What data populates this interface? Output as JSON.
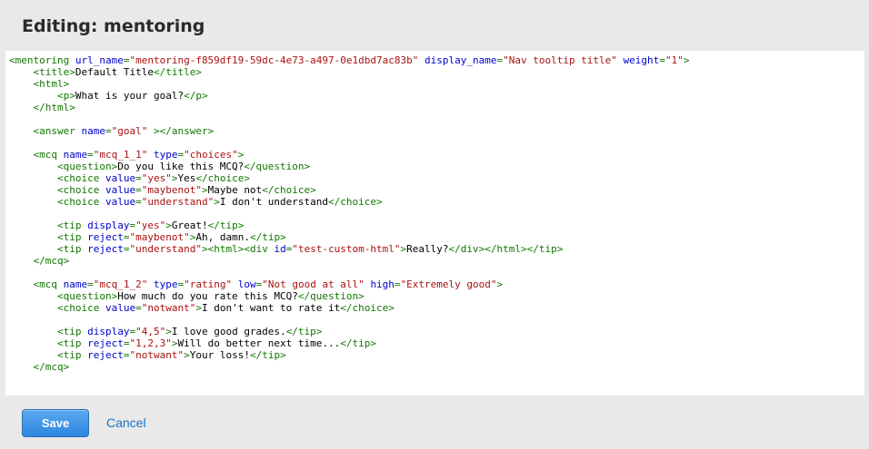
{
  "header": {
    "title": "Editing: mentoring"
  },
  "editor": {
    "lines": [
      [
        [
          "tag",
          "<mentoring "
        ],
        [
          "attr",
          "url_name"
        ],
        [
          "tag",
          "="
        ],
        [
          "val",
          "\"mentoring-f859df19-59dc-4e73-a497-0e1dbd7ac83b\""
        ],
        [
          "txt",
          " "
        ],
        [
          "attr",
          "display_name"
        ],
        [
          "tag",
          "="
        ],
        [
          "val",
          "\"Nav tooltip title\""
        ],
        [
          "txt",
          " "
        ],
        [
          "attr",
          "weight"
        ],
        [
          "tag",
          "="
        ],
        [
          "val",
          "\"1\""
        ],
        [
          "tag",
          ">"
        ]
      ],
      [
        [
          "txt",
          "    "
        ],
        [
          "tag",
          "<title>"
        ],
        [
          "txt",
          "Default Title"
        ],
        [
          "tag",
          "</title>"
        ]
      ],
      [
        [
          "txt",
          "    "
        ],
        [
          "tag",
          "<html>"
        ]
      ],
      [
        [
          "txt",
          "        "
        ],
        [
          "tag",
          "<p>"
        ],
        [
          "txt",
          "What is your goal?"
        ],
        [
          "tag",
          "</p>"
        ]
      ],
      [
        [
          "txt",
          "    "
        ],
        [
          "tag",
          "</html>"
        ]
      ],
      [
        [
          "txt",
          ""
        ]
      ],
      [
        [
          "txt",
          "    "
        ],
        [
          "tag",
          "<answer "
        ],
        [
          "attr",
          "name"
        ],
        [
          "tag",
          "="
        ],
        [
          "val",
          "\"goal\""
        ],
        [
          "tag",
          " ></answer>"
        ]
      ],
      [
        [
          "txt",
          ""
        ]
      ],
      [
        [
          "txt",
          "    "
        ],
        [
          "tag",
          "<mcq "
        ],
        [
          "attr",
          "name"
        ],
        [
          "tag",
          "="
        ],
        [
          "val",
          "\"mcq_1_1\""
        ],
        [
          "txt",
          " "
        ],
        [
          "attr",
          "type"
        ],
        [
          "tag",
          "="
        ],
        [
          "val",
          "\"choices\""
        ],
        [
          "tag",
          ">"
        ]
      ],
      [
        [
          "txt",
          "        "
        ],
        [
          "tag",
          "<question>"
        ],
        [
          "txt",
          "Do you like this MCQ?"
        ],
        [
          "tag",
          "</question>"
        ]
      ],
      [
        [
          "txt",
          "        "
        ],
        [
          "tag",
          "<choice "
        ],
        [
          "attr",
          "value"
        ],
        [
          "tag",
          "="
        ],
        [
          "val",
          "\"yes\""
        ],
        [
          "tag",
          ">"
        ],
        [
          "txt",
          "Yes"
        ],
        [
          "tag",
          "</choice>"
        ]
      ],
      [
        [
          "txt",
          "        "
        ],
        [
          "tag",
          "<choice "
        ],
        [
          "attr",
          "value"
        ],
        [
          "tag",
          "="
        ],
        [
          "val",
          "\"maybenot\""
        ],
        [
          "tag",
          ">"
        ],
        [
          "txt",
          "Maybe not"
        ],
        [
          "tag",
          "</choice>"
        ]
      ],
      [
        [
          "txt",
          "        "
        ],
        [
          "tag",
          "<choice "
        ],
        [
          "attr",
          "value"
        ],
        [
          "tag",
          "="
        ],
        [
          "val",
          "\"understand\""
        ],
        [
          "tag",
          ">"
        ],
        [
          "txt",
          "I don't understand"
        ],
        [
          "tag",
          "</choice>"
        ]
      ],
      [
        [
          "txt",
          ""
        ]
      ],
      [
        [
          "txt",
          "        "
        ],
        [
          "tag",
          "<tip "
        ],
        [
          "attr",
          "display"
        ],
        [
          "tag",
          "="
        ],
        [
          "val",
          "\"yes\""
        ],
        [
          "tag",
          ">"
        ],
        [
          "txt",
          "Great!"
        ],
        [
          "tag",
          "</tip>"
        ]
      ],
      [
        [
          "txt",
          "        "
        ],
        [
          "tag",
          "<tip "
        ],
        [
          "attr",
          "reject"
        ],
        [
          "tag",
          "="
        ],
        [
          "val",
          "\"maybenot\""
        ],
        [
          "tag",
          ">"
        ],
        [
          "txt",
          "Ah, damn."
        ],
        [
          "tag",
          "</tip>"
        ]
      ],
      [
        [
          "txt",
          "        "
        ],
        [
          "tag",
          "<tip "
        ],
        [
          "attr",
          "reject"
        ],
        [
          "tag",
          "="
        ],
        [
          "val",
          "\"understand\""
        ],
        [
          "tag",
          "><html><div "
        ],
        [
          "attr",
          "id"
        ],
        [
          "tag",
          "="
        ],
        [
          "val",
          "\"test-custom-html\""
        ],
        [
          "tag",
          ">"
        ],
        [
          "txt",
          "Really?"
        ],
        [
          "tag",
          "</div></html></tip>"
        ]
      ],
      [
        [
          "txt",
          "    "
        ],
        [
          "tag",
          "</mcq>"
        ]
      ],
      [
        [
          "txt",
          ""
        ]
      ],
      [
        [
          "txt",
          "    "
        ],
        [
          "tag",
          "<mcq "
        ],
        [
          "attr",
          "name"
        ],
        [
          "tag",
          "="
        ],
        [
          "val",
          "\"mcq_1_2\""
        ],
        [
          "txt",
          " "
        ],
        [
          "attr",
          "type"
        ],
        [
          "tag",
          "="
        ],
        [
          "val",
          "\"rating\""
        ],
        [
          "txt",
          " "
        ],
        [
          "attr",
          "low"
        ],
        [
          "tag",
          "="
        ],
        [
          "val",
          "\"Not good at all\""
        ],
        [
          "txt",
          " "
        ],
        [
          "attr",
          "high"
        ],
        [
          "tag",
          "="
        ],
        [
          "val",
          "\"Extremely good\""
        ],
        [
          "tag",
          ">"
        ]
      ],
      [
        [
          "txt",
          "        "
        ],
        [
          "tag",
          "<question>"
        ],
        [
          "txt",
          "How much do you rate this MCQ?"
        ],
        [
          "tag",
          "</question>"
        ]
      ],
      [
        [
          "txt",
          "        "
        ],
        [
          "tag",
          "<choice "
        ],
        [
          "attr",
          "value"
        ],
        [
          "tag",
          "="
        ],
        [
          "val",
          "\"notwant\""
        ],
        [
          "tag",
          ">"
        ],
        [
          "txt",
          "I don't want to rate it"
        ],
        [
          "tag",
          "</choice>"
        ]
      ],
      [
        [
          "txt",
          ""
        ]
      ],
      [
        [
          "txt",
          "        "
        ],
        [
          "tag",
          "<tip "
        ],
        [
          "attr",
          "display"
        ],
        [
          "tag",
          "="
        ],
        [
          "val",
          "\"4,5\""
        ],
        [
          "tag",
          ">"
        ],
        [
          "txt",
          "I love good grades."
        ],
        [
          "tag",
          "</tip>"
        ]
      ],
      [
        [
          "txt",
          "        "
        ],
        [
          "tag",
          "<tip "
        ],
        [
          "attr",
          "reject"
        ],
        [
          "tag",
          "="
        ],
        [
          "val",
          "\"1,2,3\""
        ],
        [
          "tag",
          ">"
        ],
        [
          "txt",
          "Will do better next time..."
        ],
        [
          "tag",
          "</tip>"
        ]
      ],
      [
        [
          "txt",
          "        "
        ],
        [
          "tag",
          "<tip "
        ],
        [
          "attr",
          "reject"
        ],
        [
          "tag",
          "="
        ],
        [
          "val",
          "\"notwant\""
        ],
        [
          "tag",
          ">"
        ],
        [
          "txt",
          "Your loss!"
        ],
        [
          "tag",
          "</tip>"
        ]
      ],
      [
        [
          "txt",
          "    "
        ],
        [
          "tag",
          "</mcq>"
        ]
      ]
    ]
  },
  "actions": {
    "save_label": "Save",
    "cancel_label": "Cancel"
  },
  "colors": {
    "tag": "#117700",
    "attribute": "#0000cc",
    "value": "#aa1111",
    "accent": "#2e86de",
    "link": "#1a73c8"
  }
}
